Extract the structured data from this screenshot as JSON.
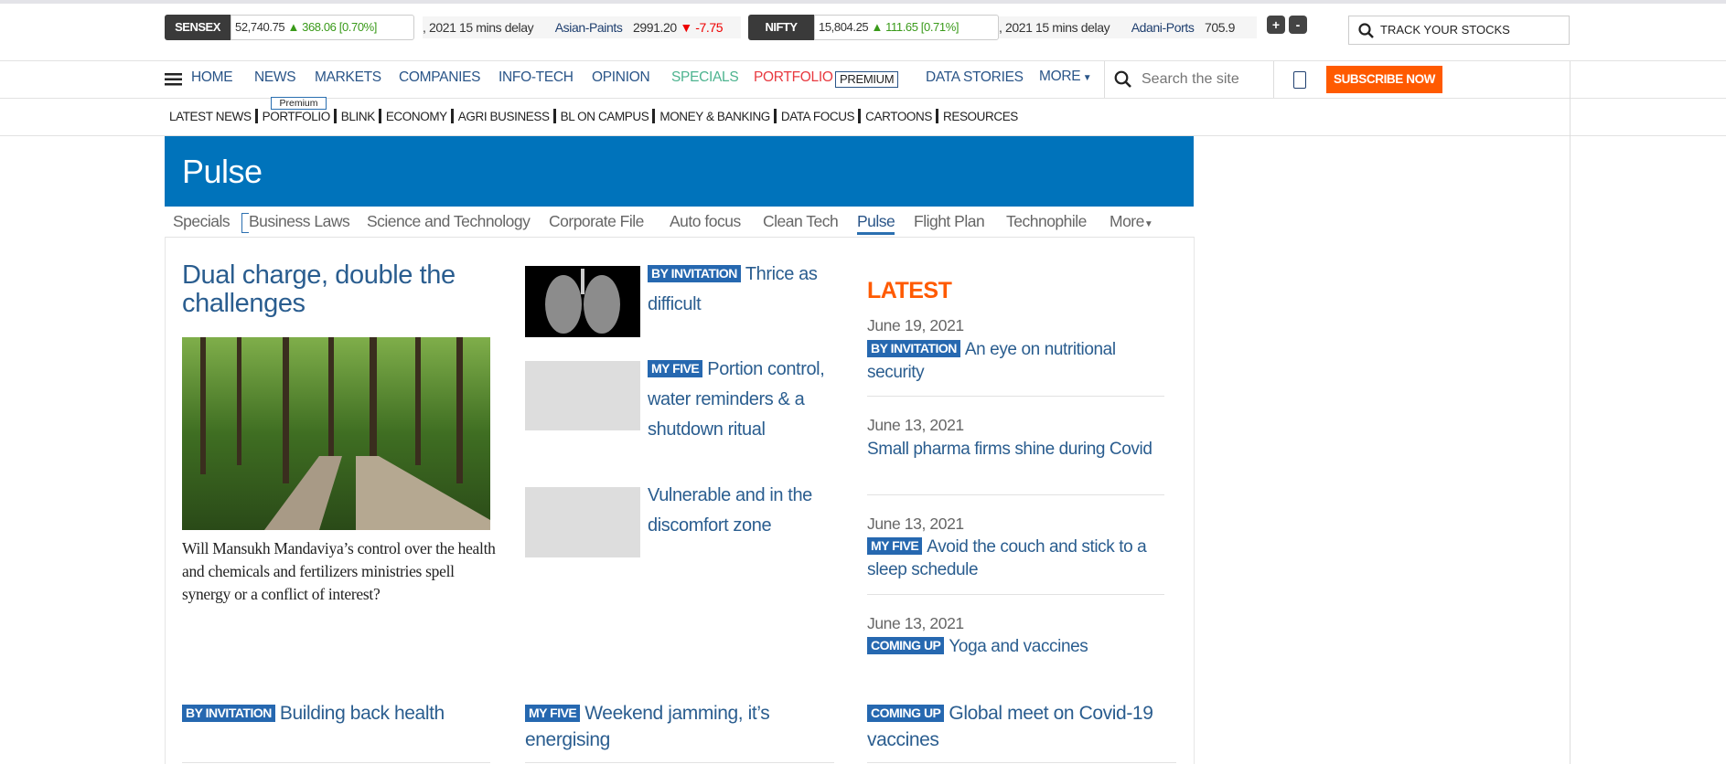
{
  "ticker": {
    "sensex": {
      "label": "SENSEX",
      "value": "52,740.75",
      "change": "368.06",
      "percent": "[0.70%]"
    },
    "sensex_scroll": {
      "delay": ", 2021 15 mins delay",
      "stock": "Asian-Paints",
      "price": "2991.20",
      "change": "-7.75"
    },
    "nifty": {
      "label": "NIFTY",
      "value": "15,804.25",
      "change": "111.65",
      "percent": "[0.71%]"
    },
    "nifty_scroll": {
      "delay": ", 2021 15 mins delay",
      "stock": "Adani-Ports",
      "price": "705.9"
    },
    "plus": "+",
    "minus": "-",
    "track": "TRACK YOUR STOCKS"
  },
  "nav": {
    "items": [
      "HOME",
      "NEWS",
      "MARKETS",
      "COMPANIES",
      "INFO-TECH",
      "OPINION",
      "SPECIALS",
      "PORTFOLIO",
      "DATA STORIES",
      "MORE"
    ],
    "premium": "PREMIUM",
    "search_placeholder": "Search the site",
    "subscribe": "SUBSCRIBE NOW"
  },
  "subnav": {
    "items": [
      "LATEST NEWS",
      "PORTFOLIO",
      "BLINK",
      "ECONOMY",
      "AGRI BUSINESS",
      "BL ON CAMPUS",
      "MONEY & BANKING",
      "DATA FOCUS",
      "CARTOONS",
      "RESOURCES"
    ],
    "premium_tag": "Premium"
  },
  "section": {
    "title": "Pulse",
    "tabs": [
      "Specials",
      "Business Laws",
      "Science and Technology",
      "Corporate File",
      "Auto focus",
      "Clean Tech",
      "Pulse",
      "Flight Plan",
      "Technophile",
      "More"
    ]
  },
  "lead": {
    "headline": "Dual charge, double the challenges",
    "summary": "Will Mansukh Mandaviya’s control over the health and chemicals and fertilizers ministries spell synergy or a conflict of interest?"
  },
  "mid_stories": [
    {
      "badge": "BY INVITATION",
      "title": "Thrice as difficult"
    },
    {
      "badge": "MY FIVE",
      "title": "Portion control, water reminders & a shutdown ritual"
    },
    {
      "badge": "",
      "title": "Vulnerable and in the discomfort zone"
    }
  ],
  "latest": {
    "heading": "LATEST",
    "items": [
      {
        "date": "June 19, 2021",
        "badge": "BY INVITATION",
        "title": "An eye on nutritional security"
      },
      {
        "date": "June 13, 2021",
        "badge": "",
        "title": "Small pharma firms shine during Covid"
      },
      {
        "date": "June 13, 2021",
        "badge": "MY FIVE",
        "title": "Avoid the couch and stick to a sleep schedule"
      },
      {
        "date": "June 13, 2021",
        "badge": "COMING UP",
        "title": "Yoga and vaccines"
      }
    ]
  },
  "bottom_stories": [
    {
      "badge": "BY INVITATION",
      "title": "Building back health"
    },
    {
      "badge": "MY FIVE",
      "title": "Weekend jamming, it’s energising"
    },
    {
      "badge": "COMING UP",
      "title": "Global meet on Covid-19 vaccines"
    }
  ],
  "colors": {
    "brand_blue": "#0073bb",
    "badge_blue": "#2668b0",
    "subscribe": "#ff5a00",
    "latest": "#ff5a00",
    "specials": "#4db38f",
    "portfolio": "#e8393f"
  }
}
